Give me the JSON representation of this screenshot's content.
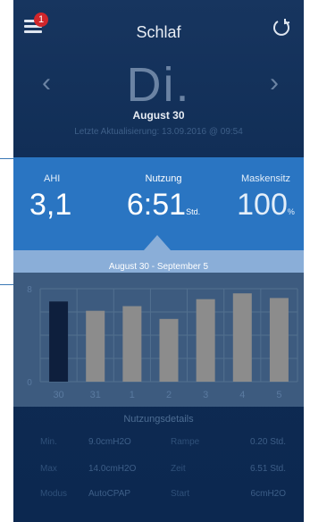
{
  "header": {
    "title": "Schlaf",
    "notification_count": "1"
  },
  "day_nav": {
    "prev": "‹",
    "next": "›",
    "day": "Di.",
    "date": "August 30",
    "last_update": "Letzte Aktualisierung: 13.09.2016 @ 09:54"
  },
  "stats": {
    "ahi_label": "AHI",
    "ahi_value": "3,1",
    "usage_label": "Nutzung",
    "usage_value": "6:51",
    "usage_unit": "Std.",
    "mask_label": "Maskensitz",
    "mask_value": "100",
    "mask_unit": "%"
  },
  "week_range": "August 30 - September 5",
  "chart_data": {
    "type": "bar",
    "categories": [
      "30",
      "31",
      "1",
      "2",
      "3",
      "4",
      "5"
    ],
    "values": [
      6.9,
      6.1,
      6.5,
      5.4,
      7.1,
      7.6,
      7.2
    ],
    "ylim": [
      0,
      8
    ],
    "yticks": [
      "8",
      "0"
    ],
    "highlight_index": 0,
    "colors": {
      "highlight": "#0e1f3d",
      "bar": "#8c8c8c",
      "grid": "#52708f"
    }
  },
  "details": {
    "title": "Nutzungsdetails",
    "rows": [
      {
        "k1": "Min.",
        "v1": "9.0cmH2O",
        "k2": "Rampe",
        "v2": "0.20 Std."
      },
      {
        "k1": "Max",
        "v1": "14.0cmH2O",
        "k2": "Zeit",
        "v2": "6.51 Std."
      },
      {
        "k1": "Modus",
        "v1": "AutoCPAP",
        "k2": "Start",
        "v2": "6cmH2O"
      }
    ]
  },
  "colors": {
    "background": "#0f2c54",
    "stats_band": "#2a75c2",
    "week_band": "#8aaed8",
    "badge": "#d0262b"
  }
}
